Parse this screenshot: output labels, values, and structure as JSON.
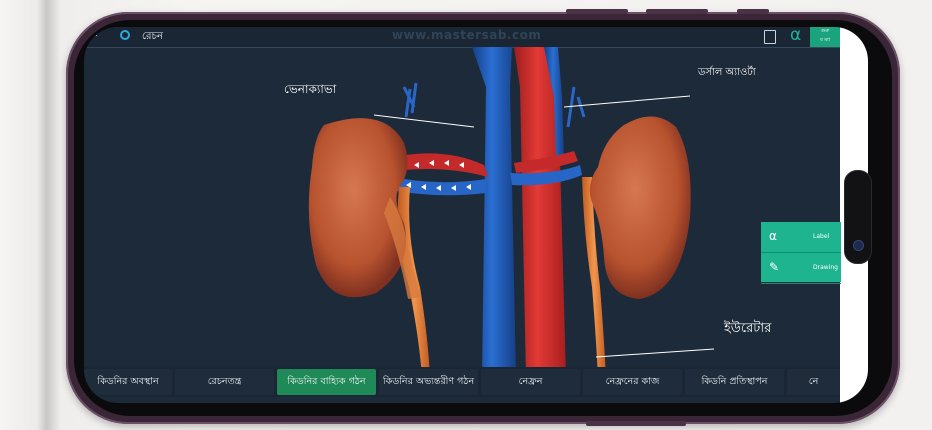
{
  "header": {
    "back_chevron": "‹",
    "title": "রেচন",
    "watermark": "www.mastersab.com",
    "alpha_symbol": "α",
    "green_badge_top": "গুরু",
    "green_badge_bottom": "ব ম্যা"
  },
  "labels": {
    "vena_cava": "ভেনাক্যাভা",
    "dorsal_aorta": "ডর্সাল অ্যাওর্টা",
    "ureter": "ইউরেটার"
  },
  "side_panel": {
    "label_icon": "α",
    "label_text": "Label",
    "drawing_icon": "✎",
    "drawing_text": "Drawing"
  },
  "tabs": [
    {
      "label": "কিডনির অবস্থান"
    },
    {
      "label": "রেচনতন্ত্র"
    },
    {
      "label": "কিডনির বাহ্যিক গঠন"
    },
    {
      "label": "কিডনির অভ্যন্তরীণ গঠন"
    },
    {
      "label": "নেফ্রন"
    },
    {
      "label": "নেফ্রনের কাজ"
    },
    {
      "label": "কিডনি প্রতিস্থাপন"
    },
    {
      "label": "নে"
    }
  ],
  "colors": {
    "active_tab": "#1f8a57",
    "kidney": "#c8603f",
    "vein": "#1f5fb8",
    "artery": "#d8312f",
    "ureter": "#e8803a",
    "accent": "#1db48f"
  },
  "icons": [
    "gear-icon",
    "document-icon",
    "alpha-icon",
    "pencil-icon",
    "camera-icon"
  ]
}
